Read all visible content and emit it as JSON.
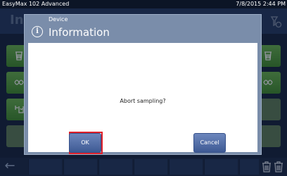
{
  "statusbar": {
    "title": "EasyMax 102 Advanced",
    "time": "7/8/2015 2:44 PM"
  },
  "app_header": {
    "title": "In",
    "icon": "filter-icon"
  },
  "side_left": [
    "jacket-icon",
    "temperature-icon",
    "stirrer-icon",
    "blank"
  ],
  "side_right": [
    "jacket-icon",
    "temperature-icon"
  ],
  "bottombar": {
    "back": "←",
    "icons": [
      "trash-icon",
      "trash-icon"
    ]
  },
  "dialog": {
    "category": "Device",
    "title": "Information",
    "info_glyph": "i",
    "message": "Abort sampling?",
    "ok_label": "OK",
    "cancel_label": "Cancel"
  },
  "colors": {
    "background": "#15233e",
    "green": "#5aa843",
    "dialog_frame": "#7a8daa",
    "button": "#4f6ba7",
    "focus": "#e0202a"
  }
}
